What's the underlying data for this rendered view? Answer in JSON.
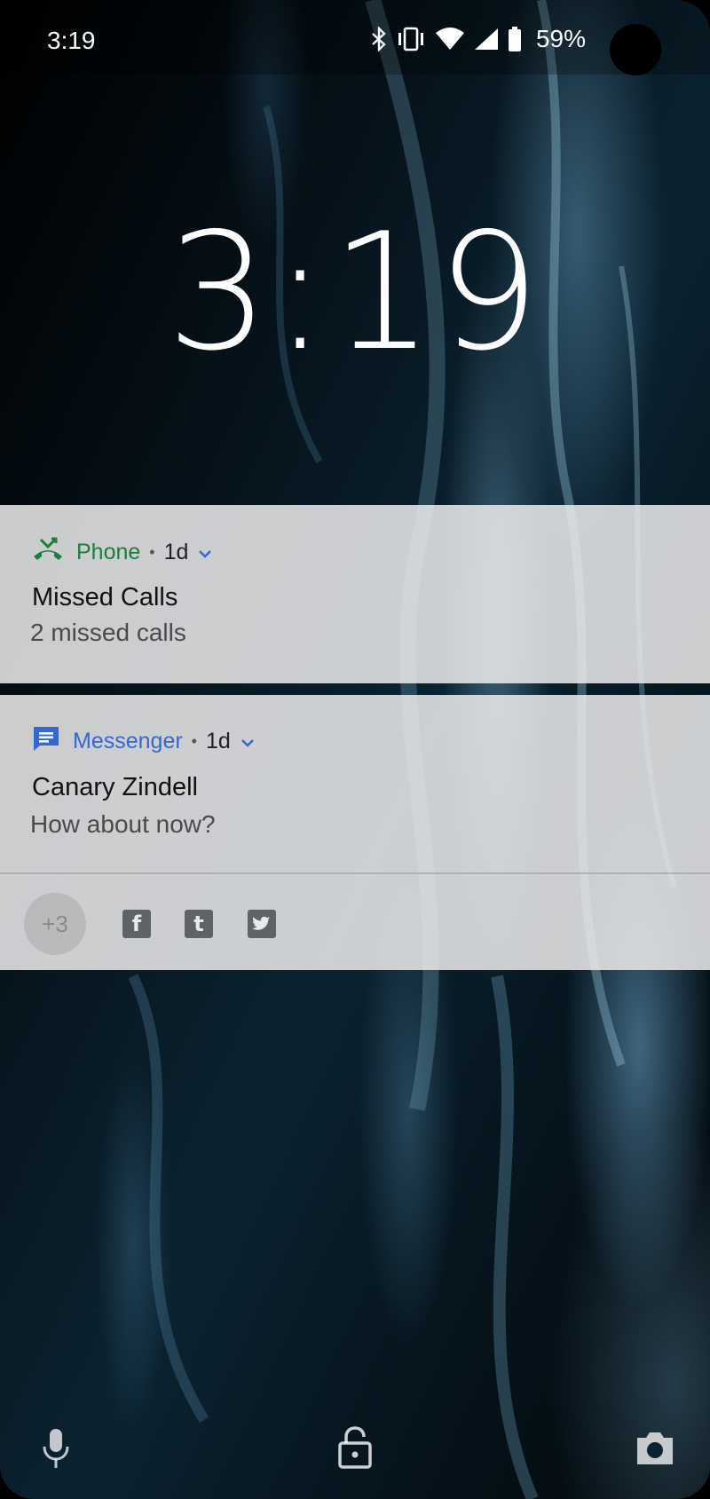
{
  "status_bar": {
    "time": "3:19",
    "icons": [
      "bluetooth-icon",
      "vibrate-icon",
      "wifi-icon",
      "signal-icon",
      "battery-icon"
    ],
    "battery_percent": "59%"
  },
  "lock_clock": "3:19",
  "notifications": [
    {
      "app": "Phone",
      "app_icon": "missed-call-icon",
      "app_color": "#188038",
      "age": "1d",
      "title": "Missed Calls",
      "body": "2 missed calls"
    },
    {
      "app": "Messenger",
      "app_icon": "messages-icon",
      "app_color": "#3367d6",
      "age": "1d",
      "title": "Canary Zindell",
      "body": "How about now?"
    }
  ],
  "overflow": {
    "count_label": "+3",
    "icons": [
      {
        "name": "facebook-icon",
        "glyph": "f"
      },
      {
        "name": "tumblr-icon",
        "glyph": "t"
      },
      {
        "name": "twitter-icon",
        "glyph": ""
      }
    ]
  },
  "bottom_shortcuts": [
    "microphone-icon",
    "lock-icon",
    "camera-icon"
  ]
}
